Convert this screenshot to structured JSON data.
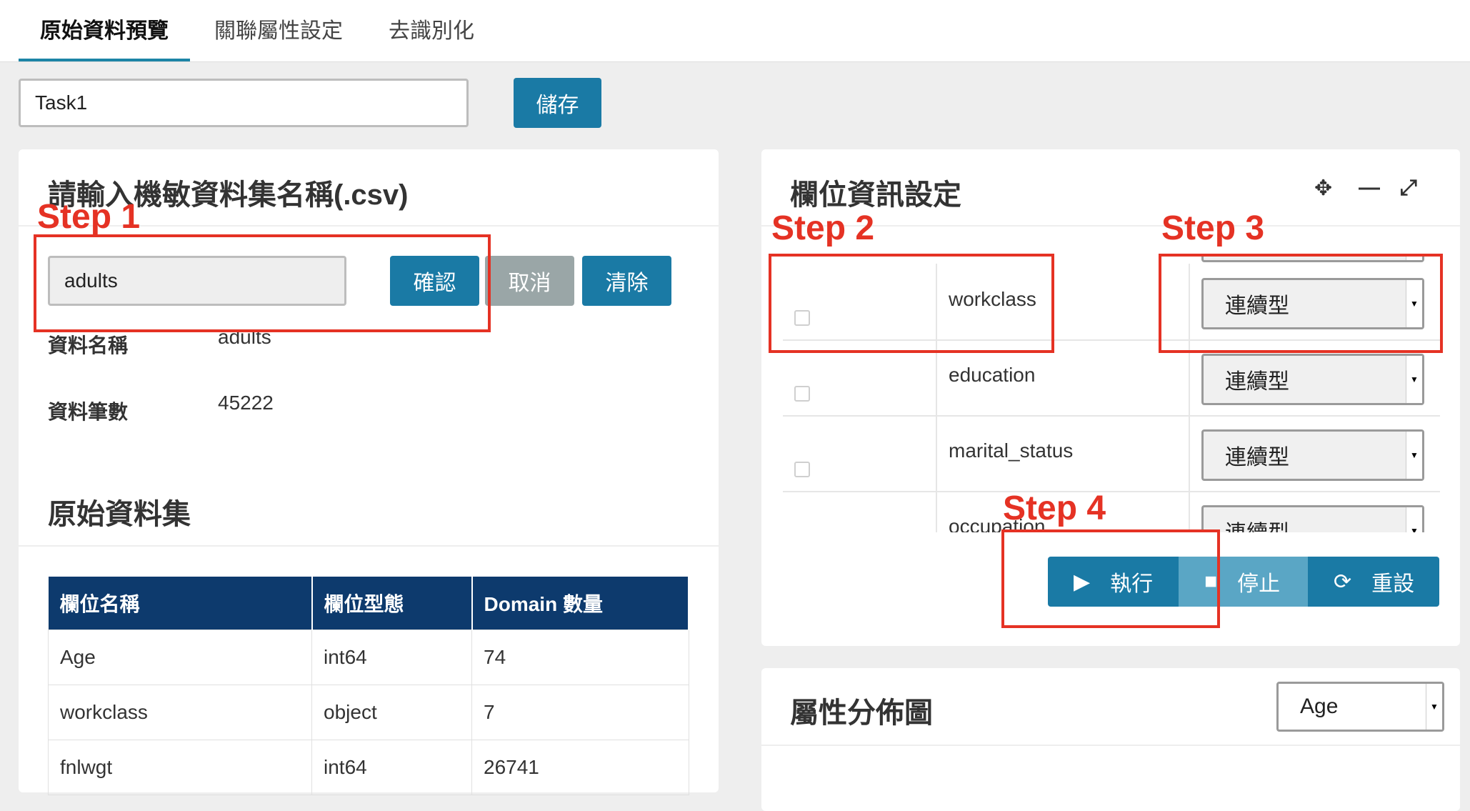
{
  "tabs": [
    {
      "label": "原始資料預覽"
    },
    {
      "label": "關聯屬性設定"
    },
    {
      "label": "去識別化"
    }
  ],
  "task": {
    "name_value": "Task1",
    "save_label": "儲存"
  },
  "dataset_panel": {
    "title": "請輸入機敏資料集名稱(.csv)",
    "input_value": "adults",
    "confirm_label": "確認",
    "cancel_label": "取消",
    "clear_label": "清除",
    "name_label": "資料名稱",
    "name_value": "adults",
    "count_label": "資料筆數",
    "count_value": "45222"
  },
  "raw_dataset": {
    "title": "原始資料集",
    "columns": [
      "欄位名稱",
      "欄位型態",
      "Domain 數量"
    ],
    "rows": [
      [
        "Age",
        "int64",
        "74"
      ],
      [
        "workclass",
        "object",
        "7"
      ],
      [
        "fnlwgt",
        "int64",
        "26741"
      ]
    ]
  },
  "field_settings": {
    "title": "欄位資訊設定",
    "icons": [
      "move-icon",
      "minimize-icon",
      "expand-icon"
    ],
    "rows": [
      {
        "name": "workclass",
        "type": "連續型"
      },
      {
        "name": "education",
        "type": "連續型"
      },
      {
        "name": "marital_status",
        "type": "連續型"
      },
      {
        "name": "occupation",
        "type": "連續型"
      }
    ],
    "run_label": "執行",
    "stop_label": "停止",
    "reset_label": "重設"
  },
  "distribution": {
    "title": "屬性分佈圖",
    "selected_attr": "Age"
  },
  "annotations": {
    "step1": "Step 1",
    "step2": "Step 2",
    "step3": "Step 3",
    "step4": "Step 4"
  },
  "colors": {
    "accent": "#1a7aa5",
    "table_header": "#0d3a6d",
    "annotation": "#e53224"
  }
}
